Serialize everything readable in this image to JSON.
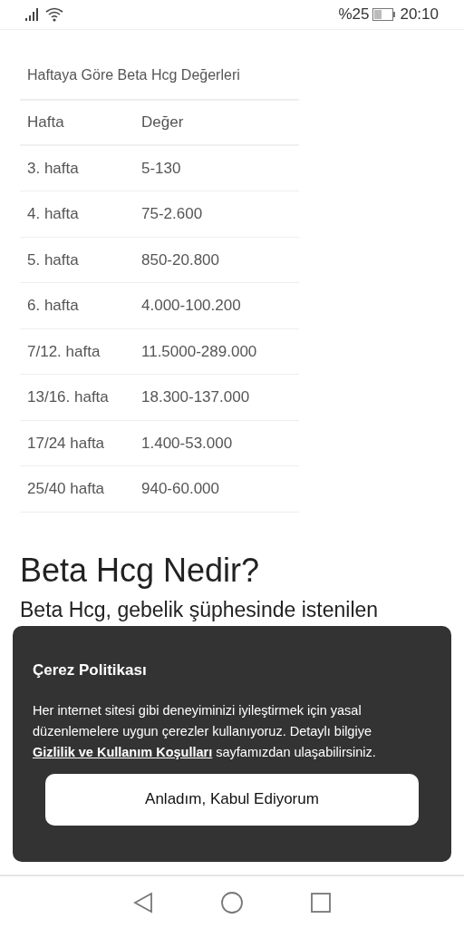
{
  "status_bar": {
    "battery": "%25",
    "time": "20:10"
  },
  "table": {
    "caption": "Haftaya Göre Beta Hcg Değerleri",
    "columns": [
      "Hafta",
      "Değer"
    ],
    "rows": [
      [
        "3. hafta",
        "5-130"
      ],
      [
        "4. hafta",
        "75-2.600"
      ],
      [
        "5. hafta",
        "850-20.800"
      ],
      [
        "6. hafta",
        "4.000-100.200"
      ],
      [
        "7/12. hafta",
        "11.5000-289.000"
      ],
      [
        "13/16. hafta",
        "18.300-137.000"
      ],
      [
        "17/24 hafta",
        "1.400-53.000"
      ],
      [
        "25/40 hafta",
        "940-60.000"
      ]
    ]
  },
  "article": {
    "heading": "Beta Hcg Nedir?",
    "paragraph": "Beta Hcg, gebelik şüphesinde istenilen"
  },
  "cookie_banner": {
    "title": "Çerez Politikası",
    "text_before": "Her internet sitesi gibi deneyiminizi iyileştirmek için yasal düzenlemelere uygun çerezler kullanıyoruz. Detaylı bilgiye",
    "link": "Gizlilik ve Kullanım Koşulları",
    "text_after": "sayfamızdan ulaşabilirsiniz.",
    "button": "Anladım, Kabul Ediyorum"
  }
}
